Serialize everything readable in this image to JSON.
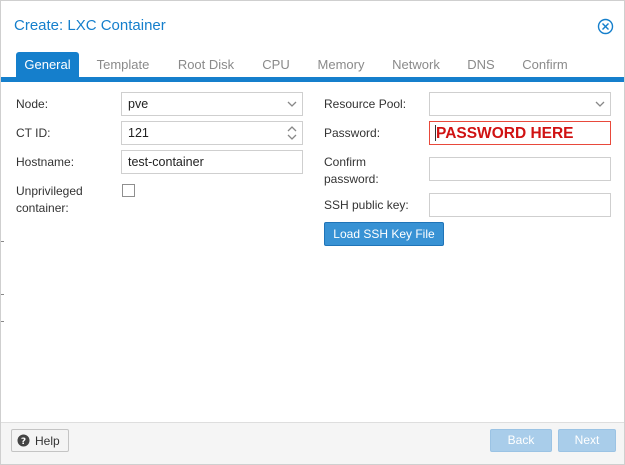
{
  "dialog": {
    "title": "Create: LXC Container",
    "close_icon": "close-circle-icon"
  },
  "tabs": [
    {
      "label": "General",
      "active": true
    },
    {
      "label": "Template",
      "active": false
    },
    {
      "label": "Root Disk",
      "active": false
    },
    {
      "label": "CPU",
      "active": false
    },
    {
      "label": "Memory",
      "active": false
    },
    {
      "label": "Network",
      "active": false
    },
    {
      "label": "DNS",
      "active": false
    },
    {
      "label": "Confirm",
      "active": false
    }
  ],
  "form_left": {
    "node_label": "Node:",
    "node_value": "pve",
    "ctid_label": "CT ID:",
    "ctid_value": "121",
    "hostname_label": "Hostname:",
    "hostname_value": "test-container",
    "unpriv_label_line1": "Unprivileged",
    "unpriv_label_line2": "container:",
    "unpriv_checked": false
  },
  "form_right": {
    "pool_label": "Resource Pool:",
    "pool_value": "",
    "password_label": "Password:",
    "password_value": "PASSWORD HERE",
    "confirm_label_line1": "Confirm",
    "confirm_label_line2": "password:",
    "confirm_value": "",
    "ssh_label": "SSH public key:",
    "ssh_value": "",
    "load_ssh_label": "Load SSH Key File"
  },
  "footer": {
    "help_label": "Help",
    "back_label": "Back",
    "next_label": "Next"
  },
  "colors": {
    "accent": "#157fcc",
    "password_text": "#d01212",
    "password_border": "#e8493b",
    "disabled_button": "#a9cdea"
  }
}
